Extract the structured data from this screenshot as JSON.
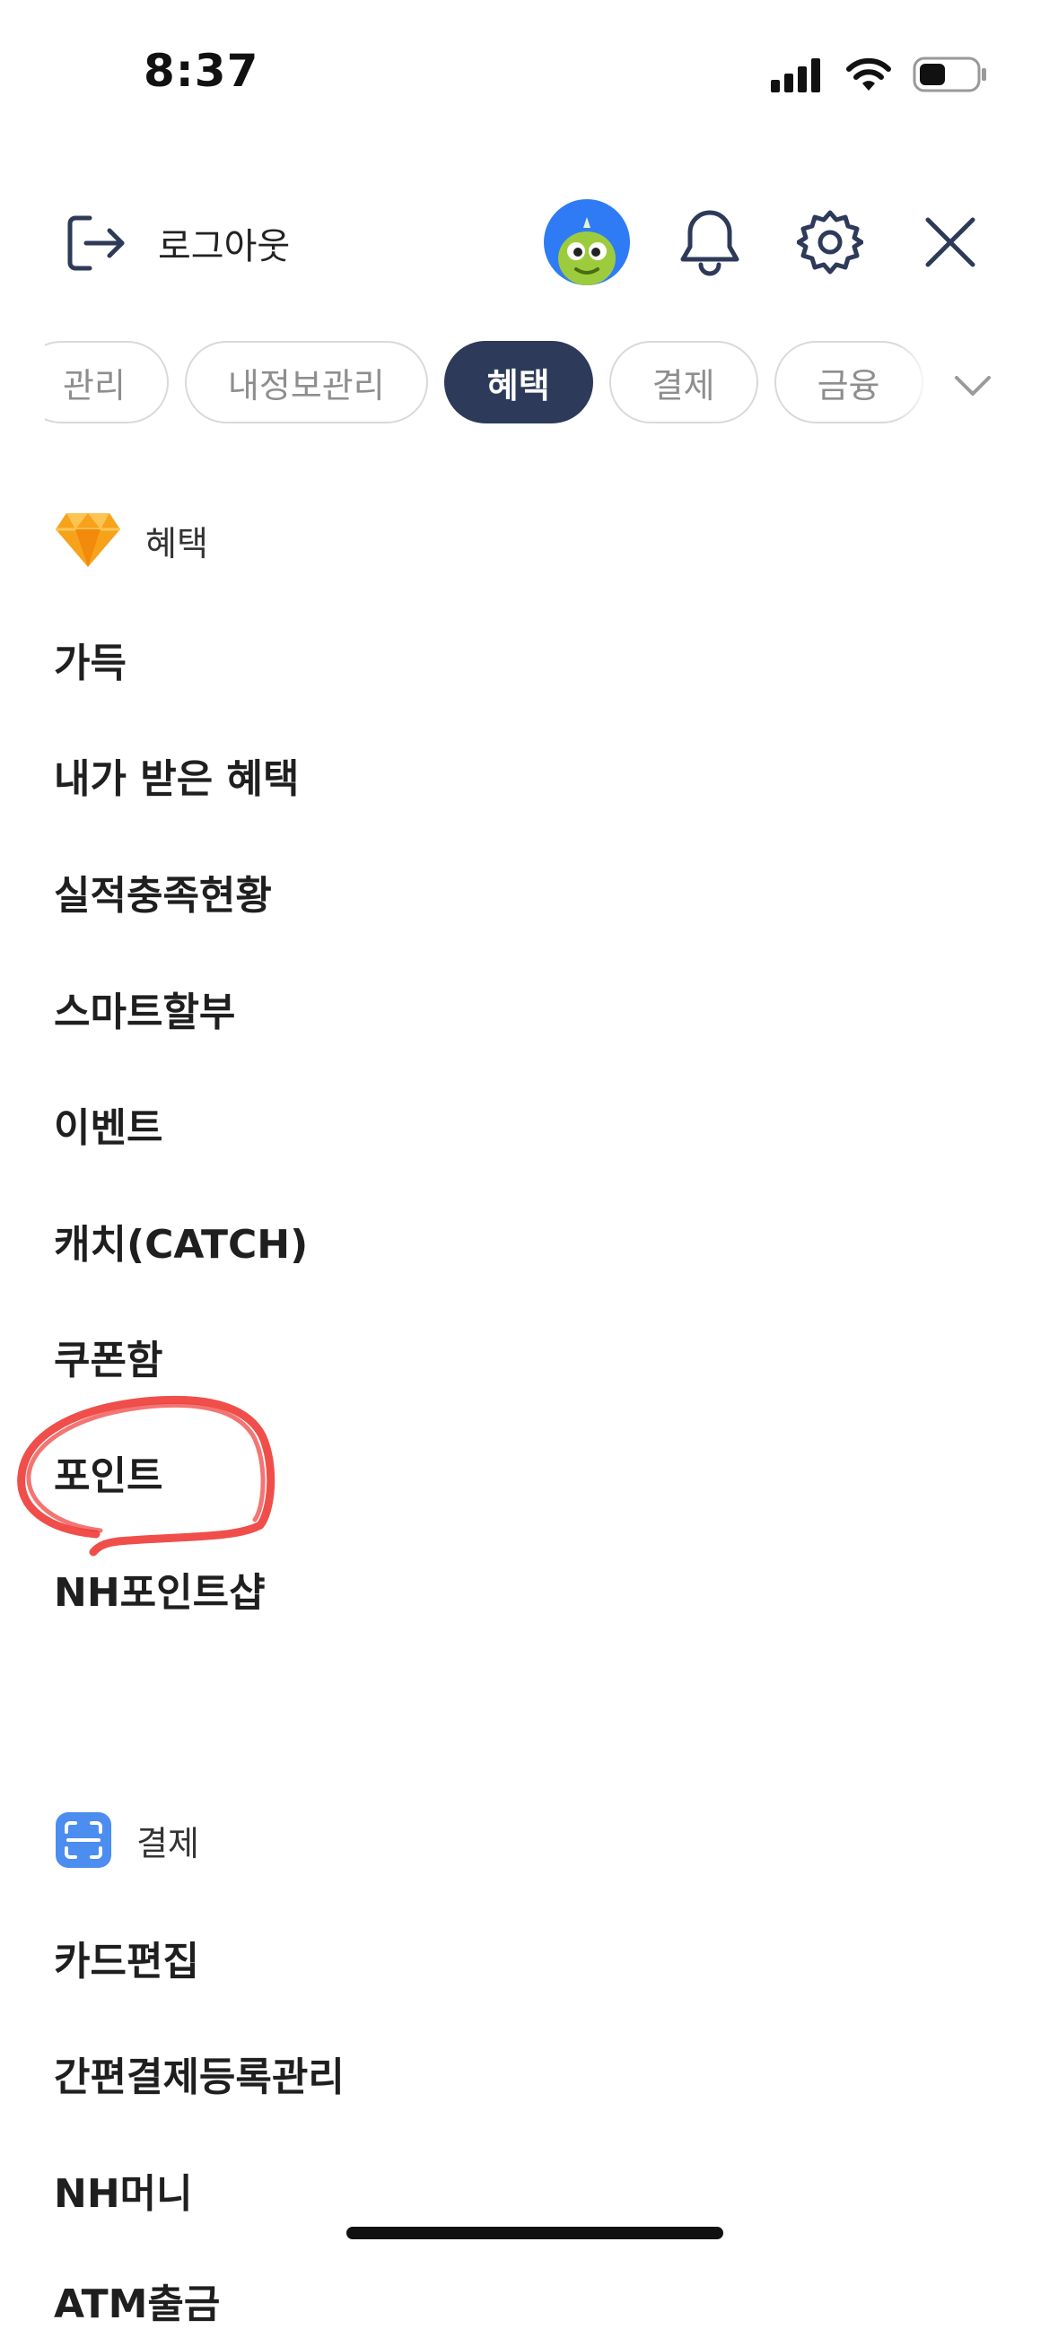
{
  "status_bar": {
    "time": "8:37"
  },
  "header": {
    "logout_label": "로그아웃"
  },
  "tabs": [
    {
      "label": "관리",
      "active": false
    },
    {
      "label": "내정보관리",
      "active": false
    },
    {
      "label": "혜택",
      "active": true
    },
    {
      "label": "결제",
      "active": false
    },
    {
      "label": "금융",
      "active": false
    }
  ],
  "sections": {
    "benefits": {
      "title": "혜택",
      "items": [
        "가득",
        "내가 받은 혜택",
        "실적충족현황",
        "스마트할부",
        "이벤트",
        "캐치(CATCH)",
        "쿠폰함",
        "포인트",
        "NH포인트샵"
      ]
    },
    "payment": {
      "title": "결제",
      "items": [
        "카드편집",
        "간편결제등록관리",
        "NH머니",
        "ATM출금"
      ]
    }
  },
  "annotation": {
    "color": "#ee3b36",
    "highlighted_item": "포인트"
  },
  "colors": {
    "active_tab": "#2d3a59",
    "avatar_bg": "#2f7bf5",
    "payment_icon": "#4c8df0",
    "benefit_icon": "#f7a21b"
  }
}
